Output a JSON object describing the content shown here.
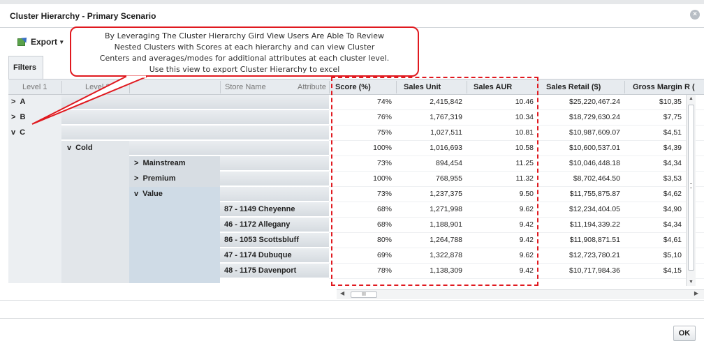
{
  "dialog": {
    "title": "Cluster Hierarchy - Primary Scenario",
    "close_icon": "close-icon"
  },
  "toolbar": {
    "export_label": "Export",
    "export_icon": "excel-export-icon",
    "export_caret": "▾"
  },
  "filters_tab": "Filters",
  "callout": {
    "lines": [
      "By Leveraging The Cluster Hierarchy Gird View Users Are Able To Review",
      "Nested Clusters with Scores at each hierarchy and  can view Cluster",
      "Centers and averages/modes for additional attributes at each cluster level.",
      "Use this view to export Cluster Hierarchy to excel"
    ],
    "color": "#e0191f"
  },
  "grid": {
    "columns": [
      "Level 1",
      "Level 2",
      "",
      "Store Name",
      "Attribute",
      "Score (%)",
      "Sales Unit",
      "Sales AUR",
      "Sales Retail ($)",
      "Gross Margin R ("
    ],
    "tree": {
      "a": "A",
      "b": "B",
      "c": "C",
      "cold": "Cold",
      "mainstream": "Mainstream",
      "premium": "Premium",
      "value": "Value"
    },
    "expand_collapsed": ">",
    "expand_open": "v",
    "stores": [
      "87 - 1149 Cheyenne",
      "46 - 1172 Allegany",
      "86 - 1053 Scottsbluff",
      "47 - 1174 Dubuque",
      "48 - 1175 Davenport"
    ],
    "rows": [
      {
        "score": "74%",
        "unit": "2,415,842",
        "aur": "10.46",
        "retail": "$25,220,467.24",
        "gm": "$10,35"
      },
      {
        "score": "76%",
        "unit": "1,767,319",
        "aur": "10.34",
        "retail": "$18,729,630.24",
        "gm": "$7,75"
      },
      {
        "score": "75%",
        "unit": "1,027,511",
        "aur": "10.81",
        "retail": "$10,987,609.07",
        "gm": "$4,51"
      },
      {
        "score": "100%",
        "unit": "1,016,693",
        "aur": "10.58",
        "retail": "$10,600,537.01",
        "gm": "$4,39"
      },
      {
        "score": "73%",
        "unit": "894,454",
        "aur": "11.25",
        "retail": "$10,046,448.18",
        "gm": "$4,34"
      },
      {
        "score": "100%",
        "unit": "768,955",
        "aur": "11.32",
        "retail": "$8,702,464.50",
        "gm": "$3,53"
      },
      {
        "score": "73%",
        "unit": "1,237,375",
        "aur": "9.50",
        "retail": "$11,755,875.87",
        "gm": "$4,62"
      },
      {
        "score": "68%",
        "unit": "1,271,998",
        "aur": "9.62",
        "retail": "$12,234,404.05",
        "gm": "$4,90"
      },
      {
        "score": "68%",
        "unit": "1,188,901",
        "aur": "9.42",
        "retail": "$11,194,339.22",
        "gm": "$4,34"
      },
      {
        "score": "80%",
        "unit": "1,264,788",
        "aur": "9.42",
        "retail": "$11,908,871.51",
        "gm": "$4,61"
      },
      {
        "score": "69%",
        "unit": "1,322,878",
        "aur": "9.62",
        "retail": "$12,723,780.21",
        "gm": "$5,10"
      },
      {
        "score": "78%",
        "unit": "1,138,309",
        "aur": "9.42",
        "retail": "$10,717,984.36",
        "gm": "$4,15"
      }
    ]
  },
  "hscroll_thumb": "III",
  "footer": {
    "ok_label": "OK"
  }
}
